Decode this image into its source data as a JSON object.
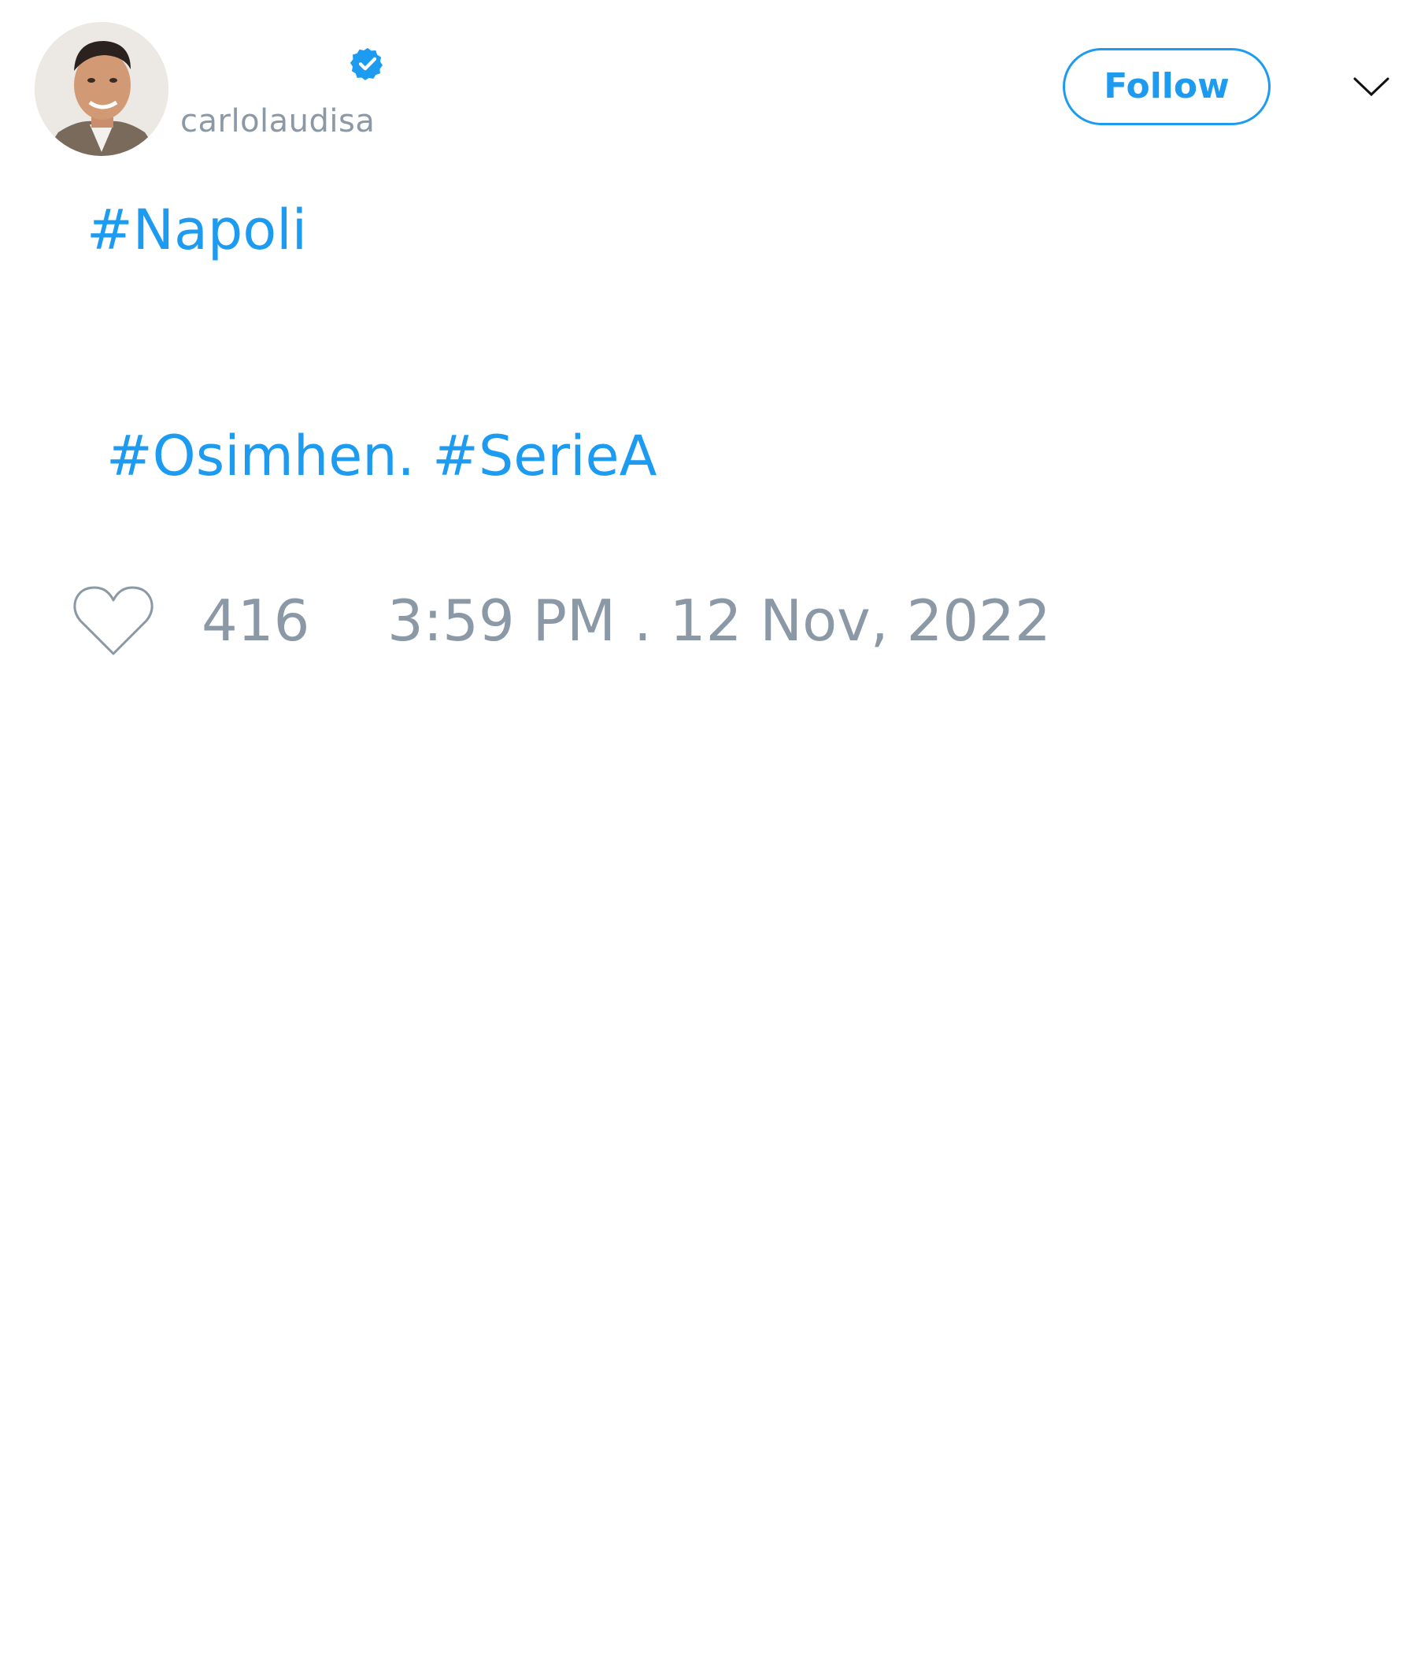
{
  "author": {
    "handle": "carlolaudisa",
    "verified": true,
    "avatar": "profile-photo"
  },
  "header": {
    "follow_label": "Follow",
    "menu_icon": "chevron-down-icon"
  },
  "tweet": {
    "hashtags": {
      "napoli": "#Napoli",
      "osimhen": "#Osimhen.",
      "seriea": "#SerieA"
    }
  },
  "footer": {
    "like_icon": "heart-icon",
    "like_count": "416",
    "timestamp": "3:59 PM . 12 Nov, 2022"
  },
  "colors": {
    "accent": "#1d9bf0",
    "muted": "#8b98a5",
    "background": "#ffffff"
  }
}
